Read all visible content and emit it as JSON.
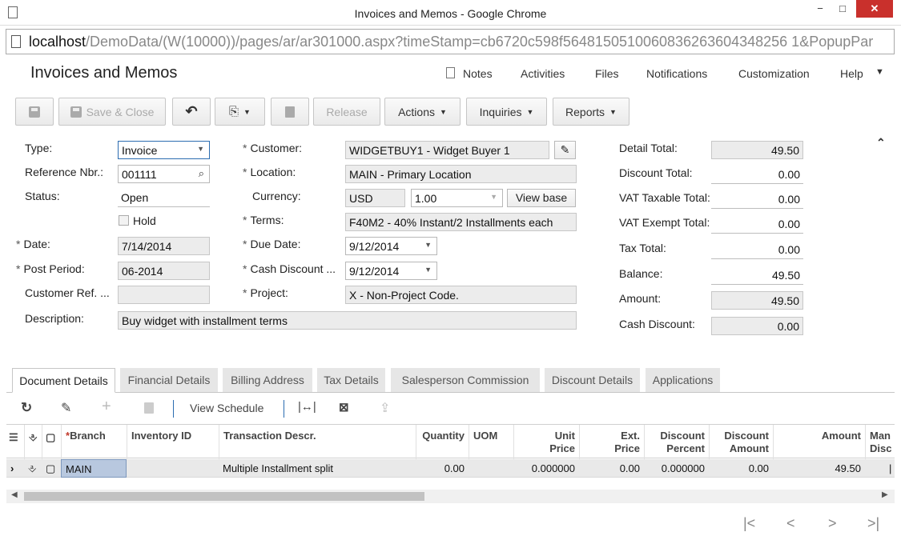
{
  "window": {
    "title": "Invoices and Memos - Google Chrome",
    "min": "−",
    "max": "□",
    "close": "✕"
  },
  "address": {
    "host": "localhost",
    "path": "/DemoData/(W(10000))/pages/ar/ar301000.aspx?timeStamp=cb6720c598f5648150510060836263604348256 1&PopupPar"
  },
  "screen": {
    "title": "Invoices and Memos"
  },
  "topnav": {
    "notes": "Notes",
    "activities": "Activities",
    "files": "Files",
    "notifications": "Notifications",
    "customization": "Customization",
    "help": "Help"
  },
  "toolbar": {
    "save_close": "Save & Close",
    "release": "Release",
    "actions": "Actions",
    "inquiries": "Inquiries",
    "reports": "Reports"
  },
  "form": {
    "type_label": "Type:",
    "type_value": "Invoice",
    "refnbr_label": "Reference Nbr.:",
    "refnbr_value": "001111",
    "status_label": "Status:",
    "status_value": "Open",
    "hold_label": "Hold",
    "date_label": "Date:",
    "date_value": "7/14/2014",
    "postperiod_label": "Post Period:",
    "postperiod_value": "06-2014",
    "custref_label": "Customer Ref. ...",
    "custref_value": "",
    "description_label": "Description:",
    "description_value": "Buy widget with installment terms",
    "customer_label": "Customer:",
    "customer_value": "WIDGETBUY1 - Widget Buyer 1",
    "location_label": "Location:",
    "location_value": "MAIN - Primary Location",
    "currency_label": "Currency:",
    "currency_value": "USD",
    "rate_value": "1.00",
    "view_base": "View base",
    "terms_label": "Terms:",
    "terms_value": "F40M2 - 40% Instant/2 Installments each",
    "duedate_label": "Due Date:",
    "duedate_value": "9/12/2014",
    "cashdisc_label": "Cash Discount ...",
    "cashdisc_value": "9/12/2014",
    "project_label": "Project:",
    "project_value": "X - Non-Project Code.",
    "detail_total_label": "Detail Total:",
    "detail_total_value": "49.50",
    "discount_total_label": "Discount Total:",
    "discount_total_value": "0.00",
    "vat_taxable_label": "VAT Taxable Total:",
    "vat_taxable_value": "0.00",
    "vat_exempt_label": "VAT Exempt Total:",
    "vat_exempt_value": "0.00",
    "tax_total_label": "Tax Total:",
    "tax_total_value": "0.00",
    "balance_label": "Balance:",
    "balance_value": "49.50",
    "amount_label": "Amount:",
    "amount_value": "49.50",
    "cash_discount_label": "Cash Discount:",
    "cash_discount_value": "0.00",
    "required_mark": "*"
  },
  "tabs": [
    "Document Details",
    "Financial Details",
    "Billing Address",
    "Tax Details",
    "Salesperson Commission",
    "Discount Details",
    "Applications"
  ],
  "grid_toolbar": {
    "view_schedule": "View Schedule"
  },
  "grid": {
    "headers": {
      "branch": "Branch",
      "inventory": "Inventory ID",
      "descr": "Transaction Descr.",
      "quantity": "Quantity",
      "uom": "UOM",
      "unit_price_1": "Unit",
      "unit_price_2": "Price",
      "ext_price_1": "Ext.",
      "ext_price_2": "Price",
      "disc_pct_1": "Discount",
      "disc_pct_2": "Percent",
      "disc_amt_1": "Discount",
      "disc_amt_2": "Amount",
      "amount": "Amount",
      "manual_1": "Man",
      "manual_2": "Disc"
    },
    "row": {
      "branch": "MAIN",
      "inventory": "",
      "descr": "Multiple Installment split",
      "quantity": "0.00",
      "uom": "",
      "unit_price": "0.000000",
      "ext_price": "0.00",
      "disc_pct": "0.000000",
      "disc_amt": "0.00",
      "amount": "49.50"
    }
  },
  "pager": {
    "first": "|<",
    "prev": "<",
    "next": ">",
    "last": ">|"
  }
}
